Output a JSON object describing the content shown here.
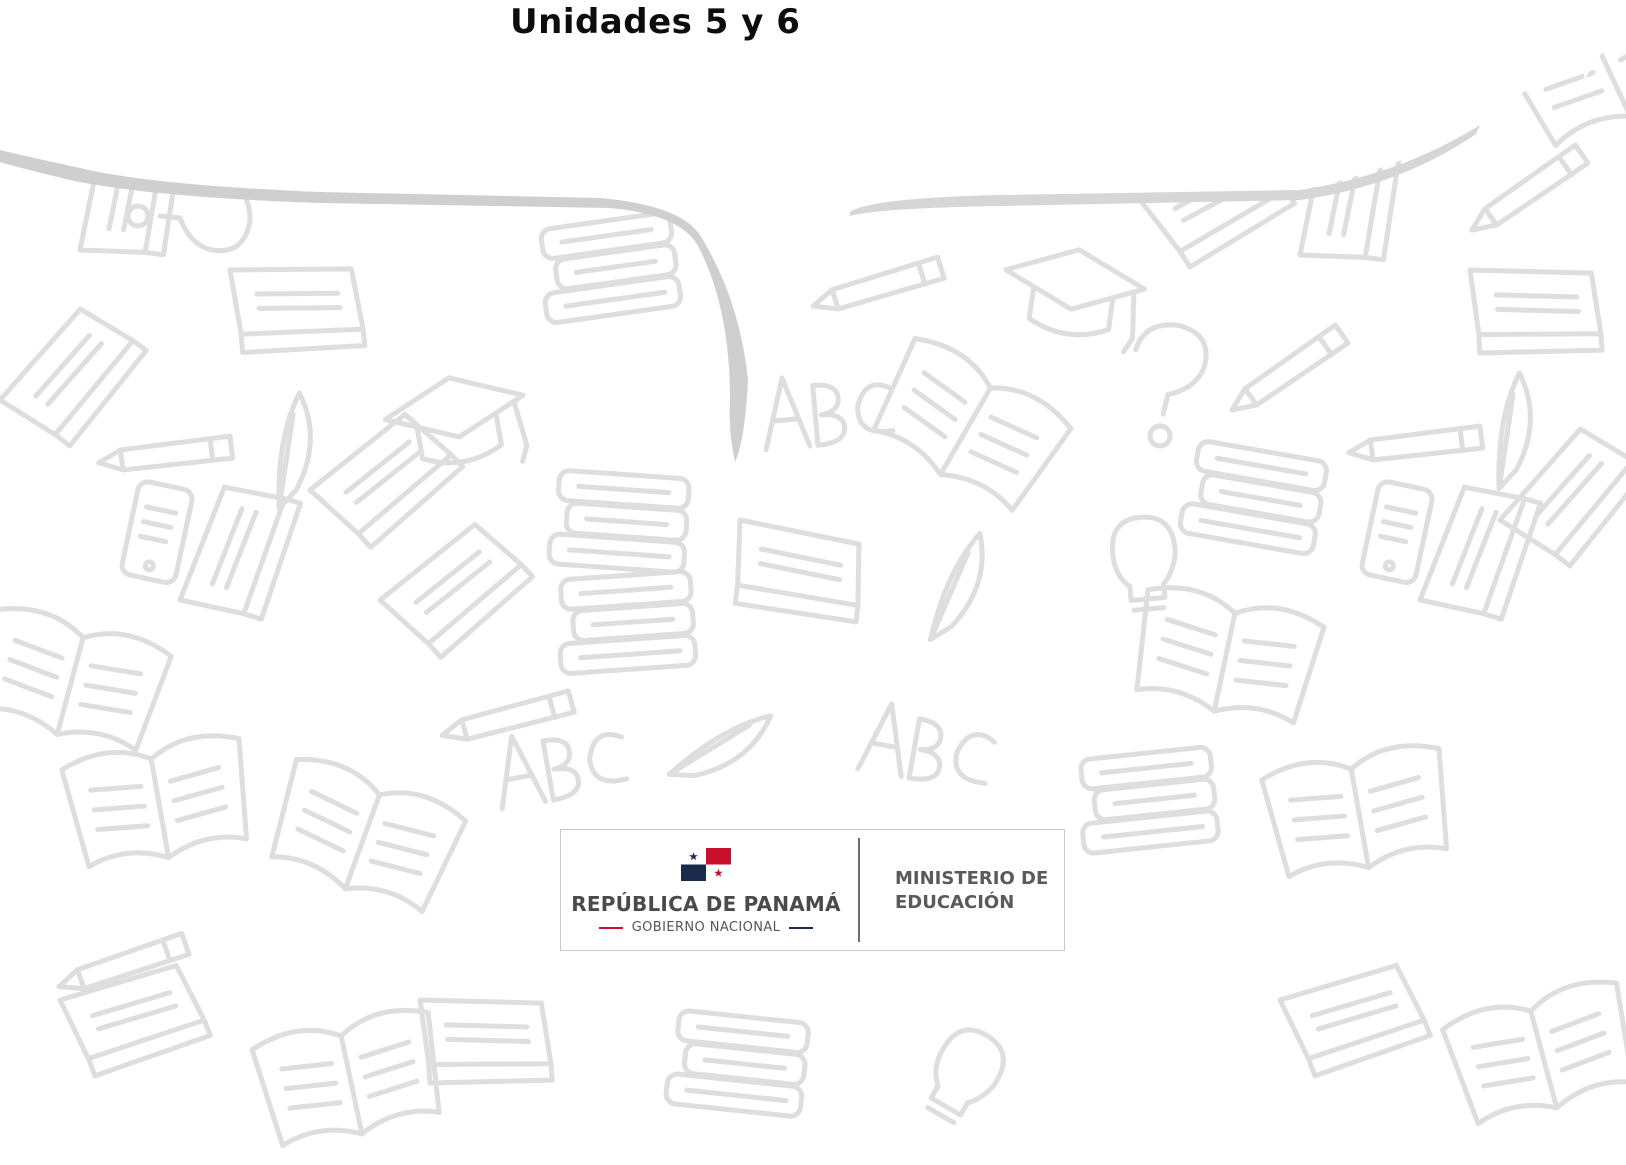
{
  "document": {
    "title": "Unidades 5 y 6"
  },
  "logo": {
    "republic": "REPÚBLICA DE PANAMÁ",
    "government": "GOBIERNO NACIONAL",
    "ministry_line1": "MINISTERIO DE",
    "ministry_line2": "EDUCACIÓN",
    "flag_colors": {
      "red": "#c8102e",
      "blue": "#1a2b4c",
      "white": "#ffffff"
    }
  },
  "background": {
    "pattern": "school-doodles",
    "stroke_color": "#dedede",
    "wave_color": "#cfcfcf"
  }
}
